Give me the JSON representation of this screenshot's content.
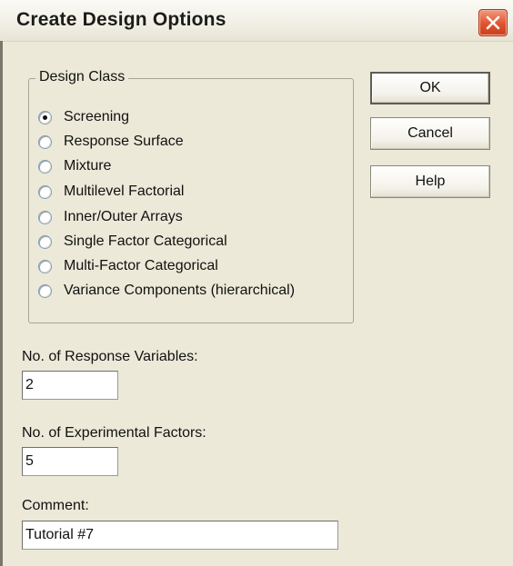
{
  "window": {
    "title": "Create Design Options"
  },
  "design_class": {
    "label": "Design Class",
    "selected": "Screening",
    "options": [
      "Screening",
      "Response Surface",
      "Mixture",
      "Multilevel Factorial",
      "Inner/Outer Arrays",
      "Single Factor Categorical",
      "Multi-Factor Categorical",
      "Variance Components (hierarchical)"
    ]
  },
  "buttons": {
    "ok": "OK",
    "cancel": "Cancel",
    "help": "Help"
  },
  "fields": {
    "response_label": "No. of Response Variables:",
    "response_value": "2",
    "factors_label": "No. of Experimental Factors:",
    "factors_value": "5",
    "comment_label": "Comment:",
    "comment_value": "Tutorial #7"
  }
}
